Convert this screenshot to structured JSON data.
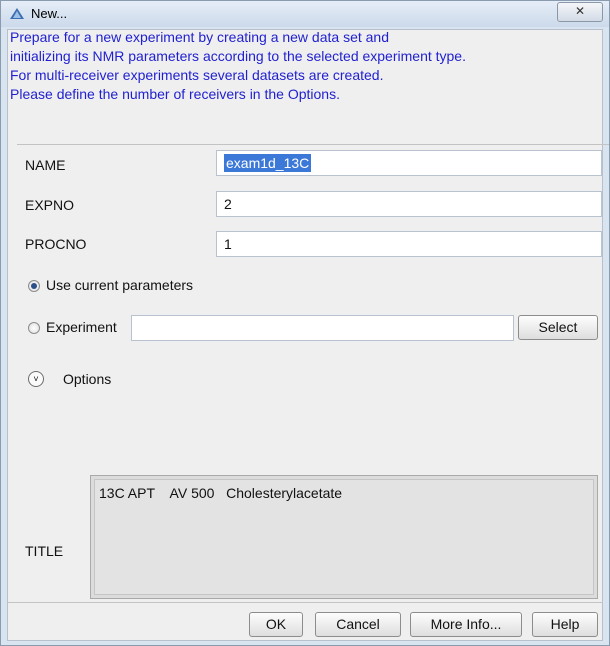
{
  "window": {
    "title": "New...",
    "close_glyph": "✕"
  },
  "description": {
    "line1": "Prepare for a new experiment by creating a new data set and",
    "line2": "initializing its NMR parameters according to the selected experiment type.",
    "line3": "For multi-receiver experiments several datasets are created.",
    "line4": "Please define the number of receivers in the Options."
  },
  "fields": {
    "name_label": "NAME",
    "name_value": "exam1d_13C",
    "expno_label": "EXPNO",
    "expno_value": "2",
    "procno_label": "PROCNO",
    "procno_value": "1"
  },
  "radio": {
    "current_label": "Use current parameters",
    "current_checked": true,
    "experiment_label": "Experiment",
    "experiment_value": "",
    "select_label": "Select"
  },
  "options": {
    "label": "Options",
    "icon": "chevron-down-icon"
  },
  "title_field": {
    "label": "TITLE",
    "value": "13C APT    AV 500   Cholesterylacetate"
  },
  "buttons": {
    "ok": "OK",
    "cancel": "Cancel",
    "more_info": "More Info...",
    "help": "Help"
  },
  "colors": {
    "description_text": "#1f1fd1",
    "selection": "#3c78d8",
    "window_frame": "#d9e4f1"
  }
}
